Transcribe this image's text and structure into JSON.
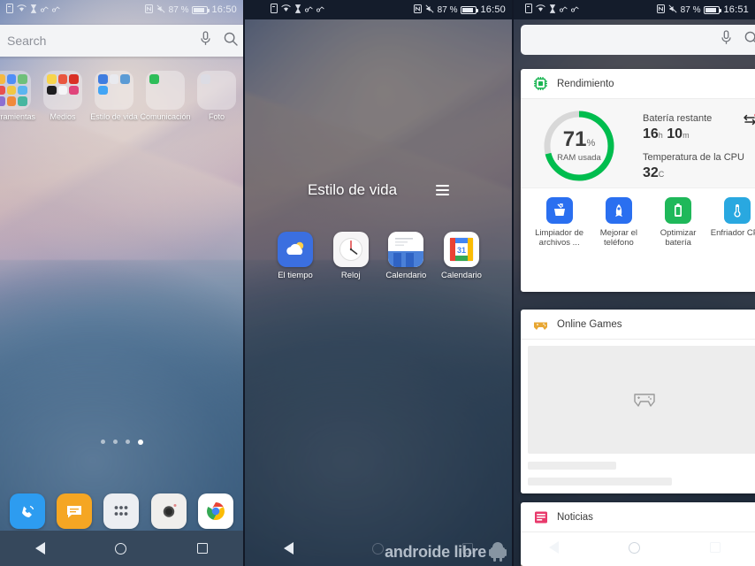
{
  "panel1": {
    "status": {
      "time": "16:50",
      "battery_percent": "87 %",
      "icons": [
        "sim-icon",
        "wifi-icon",
        "hourglass-icon",
        "accessibility-icon",
        "accessibility-icon-2",
        "nfc-icon",
        "mute-icon",
        "battery-icon"
      ]
    },
    "search": {
      "placeholder": "Search",
      "mic_icon": "microphone-icon",
      "search_icon": "search-icon"
    },
    "folders": [
      {
        "label": "Herramientas",
        "colors": [
          "#f5b942",
          "#4f8ef7",
          "#6ec07a",
          "#e84f4f",
          "#f2c744",
          "#5bb5f0",
          "#8d6fd1",
          "#f08a3c",
          "#47b6a0"
        ]
      },
      {
        "label": "Medios",
        "colors": [
          "#f7d44c",
          "#e9563f",
          "#d93025",
          "#1d1d1f",
          "#ffffff",
          "#e0457b",
          "#ffffff",
          "#ffffff",
          "#ffffff"
        ]
      },
      {
        "label": "Estilo de vida",
        "colors": [
          "#3f7de0",
          "#e9eaef",
          "#5b9bd5",
          "#42a5f5",
          "#ffffff",
          "#ffffff",
          "#ffffff",
          "#ffffff",
          "#ffffff"
        ]
      },
      {
        "label": "Comunicación",
        "colors": [
          "#2ebd59",
          "#ffffff",
          "#ffffff",
          "#ffffff",
          "#ffffff",
          "#ffffff",
          "#ffffff",
          "#ffffff",
          "#ffffff"
        ]
      },
      {
        "label": "Foto",
        "colors": [
          "#dcdce4",
          "#ffffff",
          "#ffffff",
          "#ffffff",
          "#ffffff",
          "#ffffff",
          "#ffffff",
          "#ffffff",
          "#ffffff"
        ]
      }
    ],
    "page_dots": {
      "count": 4,
      "active_index": 3
    },
    "dock": [
      {
        "name": "phone-app-icon",
        "color": "#2d9cf0",
        "glyph": ""
      },
      {
        "name": "messages-app-icon",
        "color": "#f5a623",
        "glyph": ""
      },
      {
        "name": "app-drawer-icon",
        "color": "#eceef2",
        "glyph": ""
      },
      {
        "name": "camera-app-icon",
        "color": "#f0eeec",
        "glyph": ""
      },
      {
        "name": "chrome-app-icon",
        "color": "#ffffff",
        "glyph": ""
      }
    ],
    "navbar": {
      "back": "back-triangle-icon",
      "home": "home-circle-icon",
      "recents": "recents-square-icon"
    }
  },
  "panel2": {
    "status": {
      "time": "16:50",
      "battery_percent": "87 %"
    },
    "folder_title": "Estilo de vida",
    "menu_icon": "hamburger-menu-icon",
    "apps": [
      {
        "label": "El tiempo",
        "icon": "weather-app-icon"
      },
      {
        "label": "Reloj",
        "icon": "clock-app-icon"
      },
      {
        "label": "Calendario",
        "icon": "calendar-app-icon"
      },
      {
        "label": "Calendario",
        "icon": "google-calendar-app-icon"
      }
    ],
    "watermark": "androide libre"
  },
  "panel3": {
    "status": {
      "time": "16:51",
      "battery_percent": "87 %"
    },
    "search": {
      "placeholder": "",
      "mic_icon": "microphone-icon",
      "search_icon": "search-icon"
    },
    "performance_card": {
      "title": "Rendimiento",
      "icon": "cpu-chip-icon",
      "ram": {
        "value": "71",
        "unit": "%",
        "caption": "RAM usada",
        "percent": 71,
        "ring_color": "#00bd4e",
        "track_color": "#d8d8d8"
      },
      "battery": {
        "label": "Batería restante",
        "hours": "16",
        "hours_unit": "h",
        "minutes": "10",
        "minutes_unit": "m"
      },
      "cpu": {
        "label": "Temperatura de la CPU",
        "value": "32",
        "unit": "C"
      },
      "swap_icon": "swap-arrows-icon",
      "tools": [
        {
          "label": "Limpiador de archivos ...",
          "icon": "file-cleaner-icon",
          "color": "#2a6ff0"
        },
        {
          "label": "Mejorar el teléfono",
          "icon": "rocket-boost-icon",
          "color": "#2a6ff0"
        },
        {
          "label": "Optimizar batería",
          "icon": "battery-boost-icon",
          "color": "#1fb85a"
        },
        {
          "label": "Enfriador CPU",
          "icon": "thermometer-icon",
          "color": "#29a8e0"
        }
      ]
    },
    "games_card": {
      "title": "Online Games",
      "icon": "gamepad-icon",
      "placeholder_icon": "gamepad-placeholder-icon"
    },
    "news_card": {
      "title": "Noticias",
      "icon": "news-list-icon"
    }
  }
}
